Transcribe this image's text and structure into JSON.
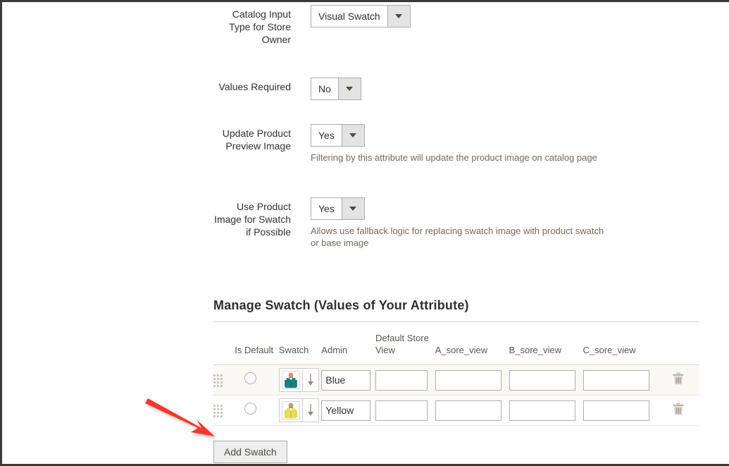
{
  "accent": {
    "arrow_red": "#f4372d",
    "text_dark": "#303030",
    "text_muted": "#736963",
    "header_gray": "#5a5753",
    "border": "#adadad",
    "row_alt_bg": "#faf8f4",
    "button_bg": "#eeeeee"
  },
  "form": {
    "fields": [
      {
        "label": "Catalog Input Type for Store Owner",
        "control": "select",
        "value": "Visual Swatch",
        "helper": ""
      },
      {
        "label": "Values Required",
        "control": "select",
        "value": "No",
        "helper": ""
      },
      {
        "label": "Update Product Preview Image",
        "control": "select",
        "value": "Yes",
        "helper": "Filtering by this attribute will update the product image on catalog page"
      },
      {
        "label": "Use Product Image for Swatch if Possible",
        "control": "select",
        "value": "Yes",
        "helper": "Allows use fallback logic for replacing swatch image with product swatch or base image"
      }
    ]
  },
  "swatch_section": {
    "title": "Manage Swatch (Values of Your Attribute)",
    "columns": [
      "",
      "Is Default",
      "Swatch",
      "Admin",
      "Default Store View",
      "A_sore_view",
      "B_sore_view",
      "C_sore_view",
      ""
    ],
    "rows": [
      {
        "is_default": false,
        "swatch_icon": "swatch-image-blue",
        "swatch_color": "#1d7f86",
        "admin": "Blue",
        "default_store_view": "",
        "a_sore_view": "",
        "b_sore_view": "",
        "c_sore_view": "",
        "delete_icon": "trash-icon"
      },
      {
        "is_default": false,
        "swatch_icon": "swatch-image-yellow",
        "swatch_color": "#e9dd5a",
        "admin": "Yellow",
        "default_store_view": "",
        "a_sore_view": "",
        "b_sore_view": "",
        "c_sore_view": "",
        "delete_icon": "trash-icon"
      }
    ],
    "add_button": "Add Swatch"
  },
  "annotation": {
    "shape": "arrow",
    "color": "#f4372d",
    "points_to": "Add Swatch"
  }
}
